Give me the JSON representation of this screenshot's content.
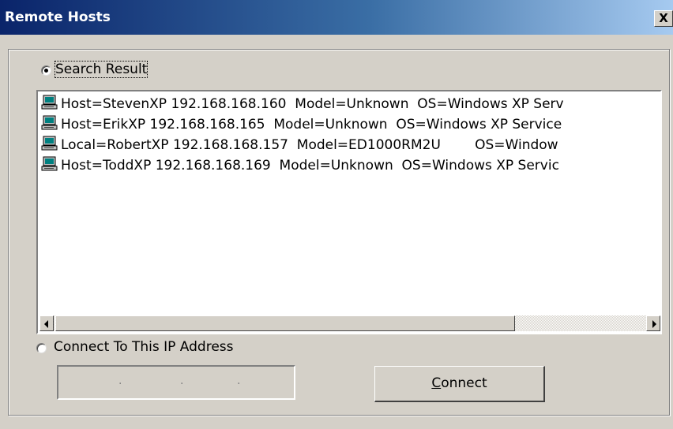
{
  "window": {
    "title": "Remote Hosts",
    "close_symbol": "X"
  },
  "search_option": {
    "label": "Search Result",
    "selected": true
  },
  "host_list": {
    "items": [
      {
        "icon": "computer-icon",
        "text": "Host=StevenXP 192.168.168.160  Model=Unknown  OS=Windows XP Serv"
      },
      {
        "icon": "computer-icon",
        "text": "Host=ErikXP 192.168.168.165  Model=Unknown  OS=Windows XP Service"
      },
      {
        "icon": "computer-icon",
        "text": "Local=RobertXP 192.168.168.157  Model=ED1000RM2U        OS=Window"
      },
      {
        "icon": "computer-icon",
        "text": "Host=ToddXP 192.168.168.169  Model=Unknown  OS=Windows XP Servic"
      }
    ]
  },
  "ip_option": {
    "label": "Connect To This IP Address",
    "selected": false
  },
  "ip_input": {
    "separator": "."
  },
  "connect_button": {
    "mnemonic": "C",
    "rest": "onnect"
  }
}
